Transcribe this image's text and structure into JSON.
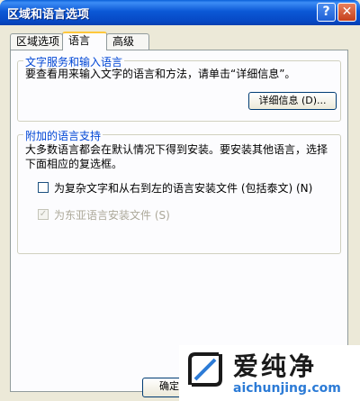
{
  "window": {
    "title": "区域和语言选项"
  },
  "tabs": [
    {
      "label": "区域选项",
      "active": false
    },
    {
      "label": "语言",
      "active": true
    },
    {
      "label": "高级",
      "active": false
    }
  ],
  "text_services": {
    "legend": "文字服务和输入语言",
    "description": "要查看用来输入文字的语言和方法，请单击“详细信息”。",
    "details_button": "详细信息 (D)..."
  },
  "supplemental": {
    "legend": "附加的语言支持",
    "description_line1": "大多数语言都会在默认情况下得到安装。要安装其他语言，选择",
    "description_line2": "下面相应的复选框。",
    "complex_script_label": "为复杂文字和从右到左的语言安装文件 (包括泰文) (N)",
    "complex_script_checked": false,
    "east_asian_label": "为东亚语言安装文件 (S)",
    "east_asian_checked": true,
    "east_asian_enabled": false
  },
  "footer": {
    "ok_button": "确定"
  },
  "watermark": {
    "name": "爱纯净",
    "url": "aichunjing.com"
  }
}
